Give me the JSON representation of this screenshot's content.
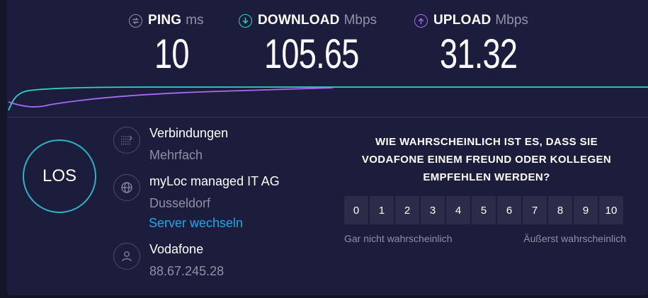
{
  "metrics": {
    "ping": {
      "label": "PING",
      "unit": "ms",
      "value": "10",
      "icon": "ping-icon",
      "color": "#8e90a5"
    },
    "download": {
      "label": "DOWNLOAD",
      "unit": "Mbps",
      "value": "105.65",
      "icon": "download-icon",
      "color": "#2fd3c6"
    },
    "upload": {
      "label": "UPLOAD",
      "unit": "Mbps",
      "value": "31.32",
      "icon": "upload-icon",
      "color": "#a56cf3"
    }
  },
  "go_button": {
    "label": "LOS",
    "color": "#2fb2c6"
  },
  "connection": {
    "title": "Verbindungen",
    "value": "Mehrfach",
    "icon": "connections-icon"
  },
  "server": {
    "title": "myLoc managed IT AG",
    "location": "Dusseldorf",
    "change_link": "Server wechseln",
    "icon": "globe-icon"
  },
  "provider": {
    "title": "Vodafone",
    "ip": "88.67.245.28",
    "icon": "user-icon"
  },
  "survey": {
    "question": "WIE WAHRSCHEINLICH IST ES, DASS SIE VODAFONE EINEM FREUND ODER KOLLEGEN EMPFEHLEN WERDEN?",
    "options": [
      "0",
      "1",
      "2",
      "3",
      "4",
      "5",
      "6",
      "7",
      "8",
      "9",
      "10"
    ],
    "low_label": "Gar nicht wahrscheinlich",
    "high_label": "Äußerst wahrscheinlich"
  }
}
